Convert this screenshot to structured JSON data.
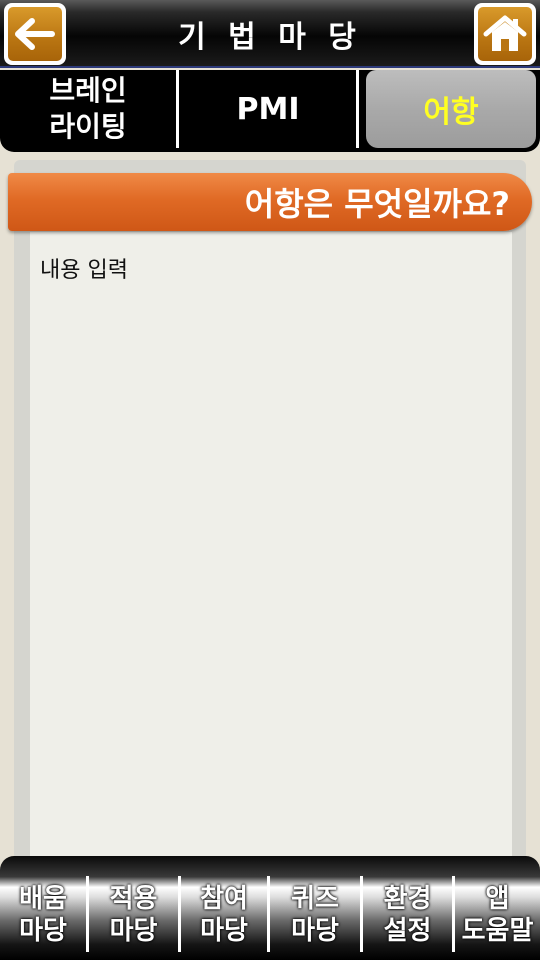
{
  "header": {
    "title": "기 법 마 당",
    "back_icon": "arrow-left-icon",
    "home_icon": "home-icon",
    "button_color": "#b97512"
  },
  "tabs": [
    {
      "label_line1": "브레인",
      "label_line2": "라이팅",
      "active": false
    },
    {
      "label": "PMI",
      "active": false
    },
    {
      "label": "어항",
      "active": true
    }
  ],
  "section": {
    "heading": "어항은 무엇일까요?",
    "body": "내용 입력",
    "accent_color": "#e06a25"
  },
  "bottom_nav": [
    {
      "line1": "배움",
      "line2": "마당"
    },
    {
      "line1": "적용",
      "line2": "마당"
    },
    {
      "line1": "참여",
      "line2": "마당"
    },
    {
      "line1": "퀴즈",
      "line2": "마당"
    },
    {
      "line1": "환경",
      "line2": "설정"
    },
    {
      "line1": "앱",
      "line2": "도움말"
    }
  ]
}
